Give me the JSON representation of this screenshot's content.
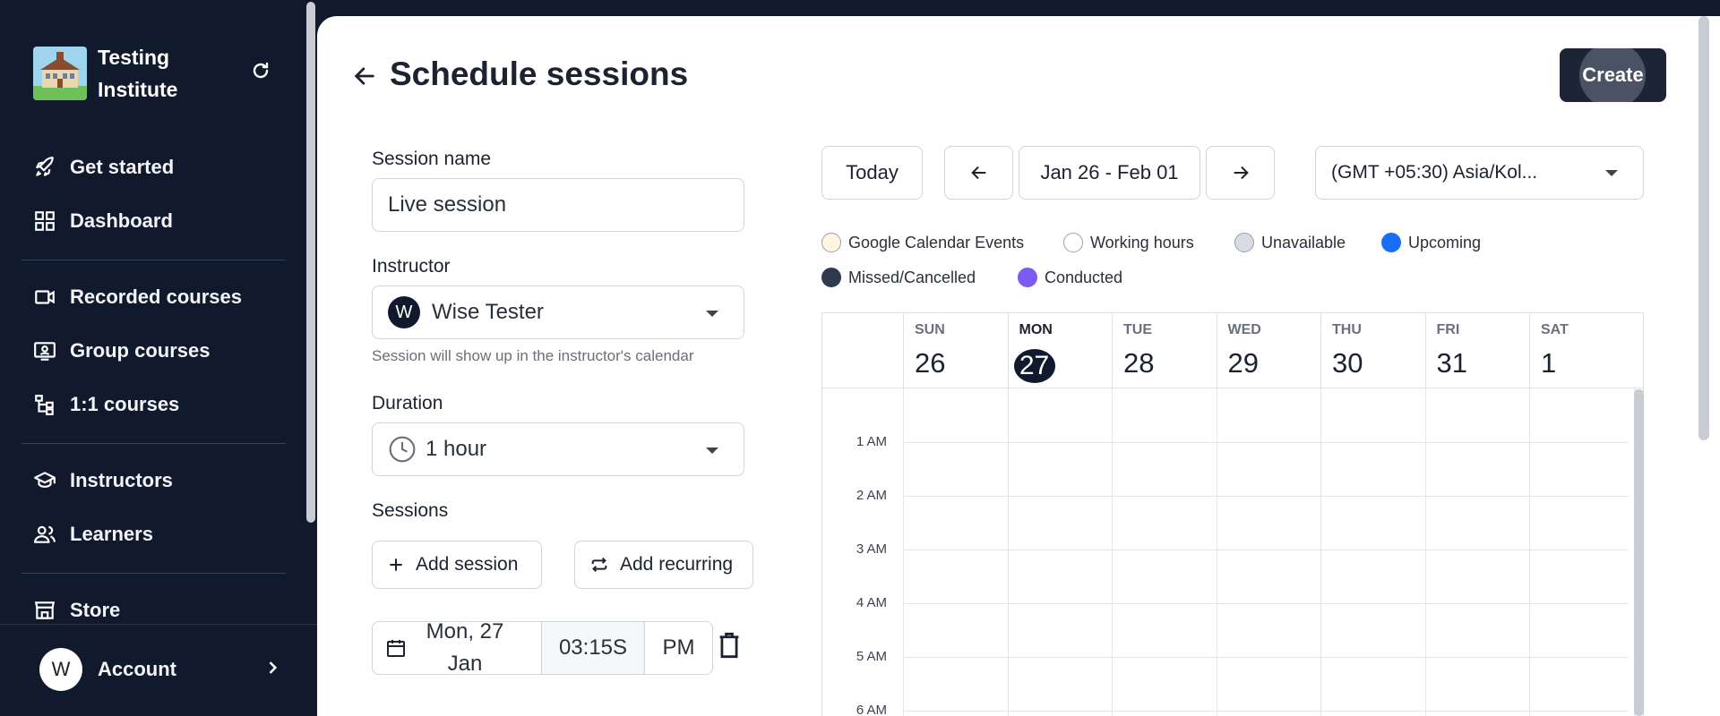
{
  "sidebar": {
    "brand_name": "Testing Institute",
    "nav": [
      {
        "label": "Get started",
        "icon": "rocket-icon"
      },
      {
        "label": "Dashboard",
        "icon": "grid-icon"
      },
      {
        "label": "Recorded courses",
        "icon": "video-icon"
      },
      {
        "label": "Group courses",
        "icon": "presentation-icon"
      },
      {
        "label": "1:1 courses",
        "icon": "tree-icon"
      },
      {
        "label": "Instructors",
        "icon": "graduation-cap-icon"
      },
      {
        "label": "Learners",
        "icon": "users-icon"
      },
      {
        "label": "Store",
        "icon": "store-icon"
      }
    ],
    "account": {
      "initial": "W",
      "label": "Account"
    }
  },
  "header": {
    "title": "Schedule sessions",
    "create_label": "Create"
  },
  "form": {
    "session_name_label": "Session name",
    "session_name_value": "Live session",
    "instructor_label": "Instructor",
    "instructor_initial": "W",
    "instructor_value": "Wise Tester",
    "instructor_hint": "Session will show up in the instructor's calendar",
    "duration_label": "Duration",
    "duration_value": "1 hour",
    "sessions_label": "Sessions",
    "add_session_label": "Add session",
    "add_recurring_label": "Add recurring",
    "session_date": "Mon, 27 Jan",
    "session_time": "03:15S",
    "session_ampm": "PM"
  },
  "calendar": {
    "today_label": "Today",
    "range_label": "Jan 26 - Feb 01",
    "timezone_label": "(GMT +05:30) Asia/Kol...",
    "legend": [
      {
        "label": "Google Calendar Events",
        "color": "#fdf6e3"
      },
      {
        "label": "Working hours",
        "color": "#ffffff"
      },
      {
        "label": "Unavailable",
        "color": "#d8dbe1"
      },
      {
        "label": "Upcoming",
        "color": "#1a6ef5"
      },
      {
        "label": "Missed/Cancelled",
        "color": "#2f3a4f"
      },
      {
        "label": "Conducted",
        "color": "#7b5cf0"
      }
    ],
    "days": [
      {
        "name": "SUN",
        "date": "26"
      },
      {
        "name": "MON",
        "date": "27"
      },
      {
        "name": "TUE",
        "date": "28"
      },
      {
        "name": "WED",
        "date": "29"
      },
      {
        "name": "THU",
        "date": "30"
      },
      {
        "name": "FRI",
        "date": "31"
      },
      {
        "name": "SAT",
        "date": "1"
      }
    ],
    "today_index": 1,
    "hours": [
      "1 AM",
      "2 AM",
      "3 AM",
      "4 AM",
      "5 AM",
      "6 AM"
    ]
  }
}
